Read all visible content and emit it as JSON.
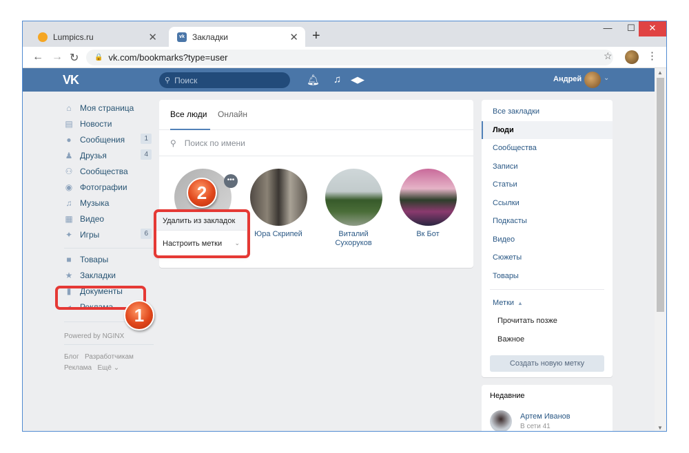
{
  "browser": {
    "tabs": [
      {
        "title": "Lumpics.ru"
      },
      {
        "title": "Закладки"
      }
    ],
    "url": "vk.com/bookmarks?type=user"
  },
  "header": {
    "logo": "VK",
    "search_placeholder": "Поиск",
    "user_name": "Андрей"
  },
  "left_menu": {
    "items": [
      {
        "label": "Моя страница",
        "icon": "home-icon",
        "badge": ""
      },
      {
        "label": "Новости",
        "icon": "news-icon",
        "badge": ""
      },
      {
        "label": "Сообщения",
        "icon": "chat-icon",
        "badge": "1"
      },
      {
        "label": "Друзья",
        "icon": "person-icon",
        "badge": "4"
      },
      {
        "label": "Сообщества",
        "icon": "group-icon",
        "badge": ""
      },
      {
        "label": "Фотографии",
        "icon": "camera-icon",
        "badge": ""
      },
      {
        "label": "Музыка",
        "icon": "music-icon",
        "badge": ""
      },
      {
        "label": "Видео",
        "icon": "video-icon",
        "badge": ""
      },
      {
        "label": "Игры",
        "icon": "gamepad-icon",
        "badge": "6"
      }
    ],
    "items2": [
      {
        "label": "Товары",
        "icon": "bag-icon"
      },
      {
        "label": "Закладки",
        "icon": "star-icon"
      },
      {
        "label": "Документы",
        "icon": "document-icon"
      },
      {
        "label": "Реклама",
        "icon": "megaphone-icon"
      }
    ],
    "powered": "Powered by NGINX",
    "footer": {
      "blog": "Блог",
      "dev": "Разработчикам",
      "ads": "Реклама",
      "more": "Ещё"
    }
  },
  "main": {
    "tabs": [
      {
        "label": "Все люди",
        "active": true
      },
      {
        "label": "Онлайн",
        "active": false
      }
    ],
    "search_placeholder": "Поиск по имени",
    "people": [
      {
        "name": ""
      },
      {
        "name": "Юра Скрипей"
      },
      {
        "name": "Виталий Сухоруков"
      },
      {
        "name": "Вк Бот"
      }
    ],
    "popup": {
      "remove": "Удалить из закладок",
      "tags": "Настроить метки"
    }
  },
  "markers": {
    "one": "1",
    "two": "2"
  },
  "right_panel": {
    "items": [
      {
        "label": "Все закладки",
        "selected": false
      },
      {
        "label": "Люди",
        "selected": true
      },
      {
        "label": "Сообщества",
        "selected": false
      },
      {
        "label": "Записи",
        "selected": false
      },
      {
        "label": "Статьи",
        "selected": false
      },
      {
        "label": "Ссылки",
        "selected": false
      },
      {
        "label": "Подкасты",
        "selected": false
      },
      {
        "label": "Видео",
        "selected": false
      },
      {
        "label": "Сюжеты",
        "selected": false
      },
      {
        "label": "Товары",
        "selected": false
      }
    ],
    "tags_label": "Метки",
    "tags": [
      "Прочитать позже",
      "Важное"
    ],
    "create_button": "Создать новую метку"
  },
  "recent": {
    "title": "Недавние",
    "name": "Артем Иванов",
    "sub": "В сети 41"
  },
  "colors": {
    "vk_blue": "#4a76a8",
    "link": "#2a5885",
    "highlight": "#e53935"
  }
}
